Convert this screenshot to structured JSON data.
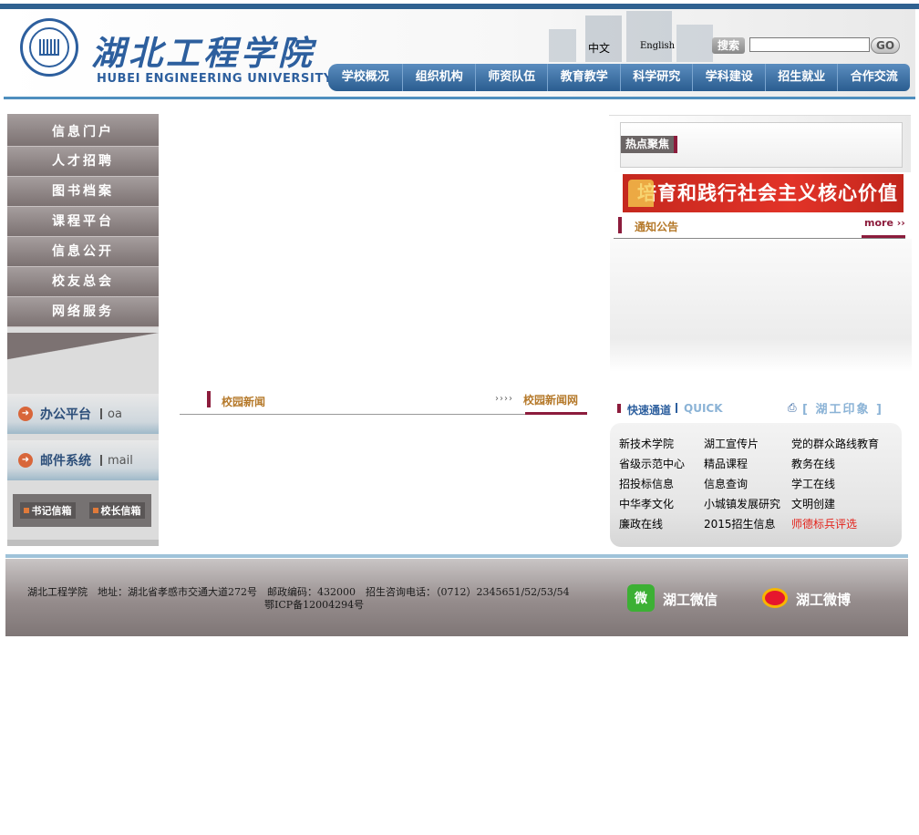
{
  "header": {
    "school_cn": "湖北工程学院",
    "school_en": "HUBEI ENGINEERING UNIVERSITY",
    "lang_cn": "中文",
    "lang_en": "English",
    "search_label": "搜索",
    "search_value": "",
    "search_go": "GO"
  },
  "nav": [
    {
      "label": "学校概况"
    },
    {
      "label": "组织机构"
    },
    {
      "label": "师资队伍"
    },
    {
      "label": "教育教学"
    },
    {
      "label": "科学研究"
    },
    {
      "label": "学科建设"
    },
    {
      "label": "招生就业"
    },
    {
      "label": "合作交流"
    }
  ],
  "left_menu": [
    {
      "label": "信息门户"
    },
    {
      "label": "人才招聘"
    },
    {
      "label": "图书档案"
    },
    {
      "label": "课程平台"
    },
    {
      "label": "信息公开"
    },
    {
      "label": "校友总会"
    },
    {
      "label": "网络服务"
    }
  ],
  "platforms": [
    {
      "label": "办公平台",
      "en": "oa"
    },
    {
      "label": "邮件系统",
      "en": "mail"
    }
  ],
  "mailboxes": [
    {
      "label": "书记信箱"
    },
    {
      "label": "校长信箱"
    }
  ],
  "news": {
    "title": "校园新闻",
    "arrows": "››››",
    "link": "校园新闻网"
  },
  "hot": {
    "title": "热点聚焦",
    "banner": "培育和践行社会主义核心价值观"
  },
  "notice": {
    "title": "通知公告",
    "more": "more ››"
  },
  "quick": {
    "title": "快速通道",
    "en": "QUICK",
    "impression_icon": "⎙",
    "impression": "[ 湖工印象 ]",
    "links": [
      [
        "新技术学院",
        "湖工宣传片",
        "党的群众路线教育"
      ],
      [
        "省级示范中心",
        "精品课程",
        "教务在线"
      ],
      [
        "招投标信息",
        "信息查询",
        "学工在线"
      ],
      [
        "中华孝文化",
        "小城镇发展研究",
        "文明创建"
      ],
      [
        "廉政在线",
        "2015招生信息",
        "师德标兵评选"
      ]
    ],
    "highlight_color": "#e3221a"
  },
  "footer": {
    "line1": "湖北工程学院　地址：湖北省孝感市交通大道272号　邮政编码：432000　招生咨询电话：（0712）2345651/52/53/54",
    "line2": "鄂ICP备12004294号",
    "wechat_icon": "微",
    "wechat": "湖工微信",
    "weibo": "湖工微博"
  },
  "colors": {
    "brand_blue": "#2d5f9e",
    "accent_maroon": "#8c1c3c",
    "title_gold": "#b5792a"
  }
}
